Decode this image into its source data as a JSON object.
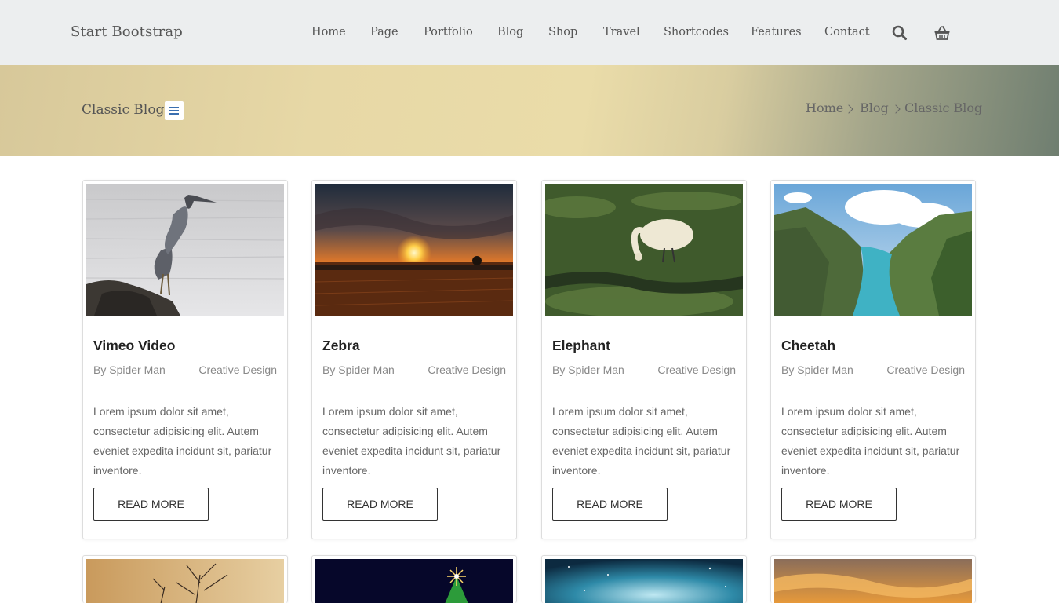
{
  "navbar": {
    "brand": "Start Bootstrap",
    "links": [
      "Home",
      "Page",
      "Portfolio",
      "Blog",
      "Shop",
      "Travel",
      "Shortcodes",
      "Features",
      "Contact"
    ],
    "icons": [
      "search-icon",
      "shopping-basket-icon"
    ]
  },
  "banner": {
    "title": "Classic Blog",
    "breadcrumb": [
      "Home",
      "Blog",
      "Classic Blog"
    ]
  },
  "cards": [
    {
      "title": "Vimeo Video",
      "author": "By Spider Man",
      "category": "Creative Design",
      "excerpt": "Lorem ipsum dolor sit amet, consectetur adipisicing elit. Autem eveniet expedita incidunt sit, pariatur inventore.",
      "button": "READ MORE"
    },
    {
      "title": "Zebra",
      "author": "By Spider Man",
      "category": "Creative Design",
      "excerpt": "Lorem ipsum dolor sit amet, consectetur adipisicing elit. Autem eveniet expedita incidunt sit, pariatur inventore.",
      "button": "READ MORE"
    },
    {
      "title": "Elephant",
      "author": "By Spider Man",
      "category": "Creative Design",
      "excerpt": "Lorem ipsum dolor sit amet, consectetur adipisicing elit. Autem eveniet expedita incidunt sit, pariatur inventore.",
      "button": "READ MORE"
    },
    {
      "title": "Cheetah",
      "author": "By Spider Man",
      "category": "Creative Design",
      "excerpt": "Lorem ipsum dolor sit amet, consectetur adipisicing elit. Autem eveniet expedita incidunt sit, pariatur inventore.",
      "button": "READ MORE"
    }
  ],
  "colors": {
    "navbar_bg": "#eceeef",
    "accent": "#3a6fb0",
    "text_muted": "#888888"
  }
}
